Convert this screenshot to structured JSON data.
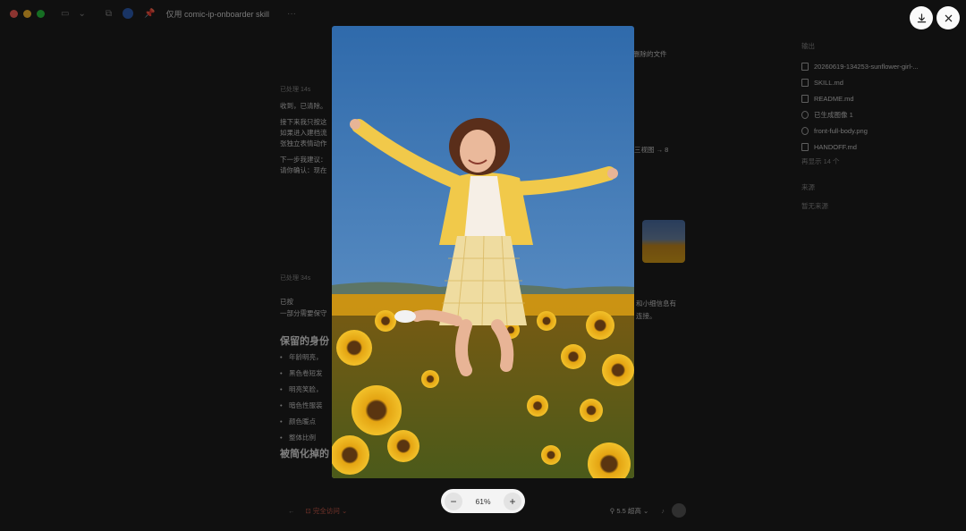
{
  "window": {
    "tab_title": "仅用 comic-ip-onboarder skill"
  },
  "chat": {
    "top_right_snippet": "删除的文件",
    "msg1_meta": "已处理 14s",
    "msg1_line1": "收到，已清除。",
    "msg1_line2": "接下来我只按这",
    "msg1_line3": "如果进入建档流",
    "msg1_line3_right": "三视图 → 8",
    "msg1_line4": "张独立表情动作",
    "msg1_line5": "下一步我建议：",
    "msg1_line6": "请你确认：现在",
    "msg2_meta": "已处理 34s",
    "msg2_line1": "已按",
    "msg2_line1_right": "和小细信息有",
    "msg2_line2": "一部分需要保守",
    "msg2_line2_right": "连接。",
    "section1_title": "保留的身份",
    "bullets": [
      "年龄明亮，",
      "黑色卷短发",
      "明亮笑脸，",
      "暗色性服装",
      "颜色暖点",
      "整体比例"
    ],
    "section2_title": "被简化掉的"
  },
  "sidebar": {
    "outputs_heading": "输出",
    "files": [
      {
        "name": "20260619-134253-sunflower-girl-...",
        "icon": "document-icon"
      },
      {
        "name": "SKILL.md",
        "icon": "document-icon"
      },
      {
        "name": "README.md",
        "icon": "document-icon"
      },
      {
        "name": "已生成图像 1",
        "icon": "image-icon"
      },
      {
        "name": "front-full-body.png",
        "icon": "image-icon"
      },
      {
        "name": "HANDOFF.md",
        "icon": "document-icon"
      }
    ],
    "more_label": "再显示 14 个",
    "section2_heading": "来源",
    "section2_empty": "暂无来源"
  },
  "composer": {
    "mode_label": "完全访问",
    "model_label": "5.5 超高"
  },
  "viewer": {
    "zoom_level": "61%",
    "zoom_out_label": "−",
    "zoom_in_label": "+",
    "download_icon": "download-icon",
    "close_icon": "close-icon",
    "image_subject": "sunflower-field-girl-jumping",
    "colors": {
      "sky": "#3d78b8",
      "sunflower": "#e3a613",
      "cardigan": "#f1c94a",
      "pill_bg": "#f4f4f4"
    }
  }
}
